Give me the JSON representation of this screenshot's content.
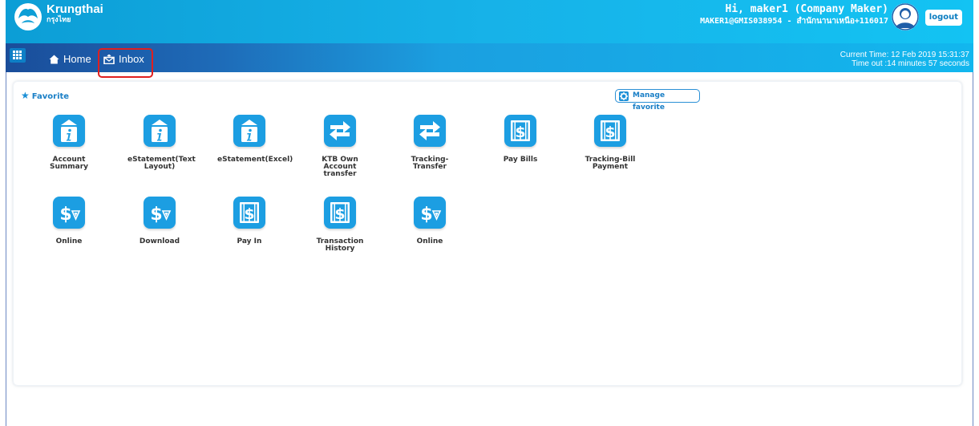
{
  "header": {
    "brand_name": "Krungthai",
    "brand_sub": "กรุงไทย",
    "greeting": "Hi, maker1 (Company Maker)",
    "user_id": "MAKER1@GMIS038954 - สำนักนานาเหนือ+116017",
    "logout_label": "logout"
  },
  "nav": {
    "home_label": "Home",
    "inbox_label": "Inbox"
  },
  "session": {
    "current_time": "Current Time: 12 Feb 2019 15:31:37",
    "timeout": "Time out :14 minutes 57 seconds"
  },
  "favorite": {
    "title": "Favorite",
    "manage_label": "Manage favorite",
    "tiles": [
      {
        "label": "Account Summary",
        "icon": "info-document-icon"
      },
      {
        "label": "eStatement(Text Layout)",
        "icon": "info-document-icon"
      },
      {
        "label": "eStatement(Excel)",
        "icon": "info-document-icon"
      },
      {
        "label": "KTB Own Account transfer",
        "icon": "transfer-arrows-icon"
      },
      {
        "label": "Tracking-Transfer",
        "icon": "transfer-arrows-icon"
      },
      {
        "label": "Pay Bills",
        "icon": "dollar-bill-icon"
      },
      {
        "label": "Tracking-Bill Payment",
        "icon": "dollar-bill-icon"
      },
      {
        "label": "Online",
        "icon": "dollar-down-icon"
      },
      {
        "label": "Download",
        "icon": "dollar-down-icon"
      },
      {
        "label": "Pay In",
        "icon": "dollar-bill-icon"
      },
      {
        "label": "Transaction History",
        "icon": "dollar-bill-icon"
      },
      {
        "label": "Online",
        "icon": "dollar-down-icon"
      }
    ]
  },
  "colors": {
    "header_blue": "#17b2e8",
    "nav_dark": "#1a4d9a",
    "tile_blue": "#1c9ee2",
    "highlight_red": "#e01f1f",
    "link_blue": "#1a7fc6"
  }
}
